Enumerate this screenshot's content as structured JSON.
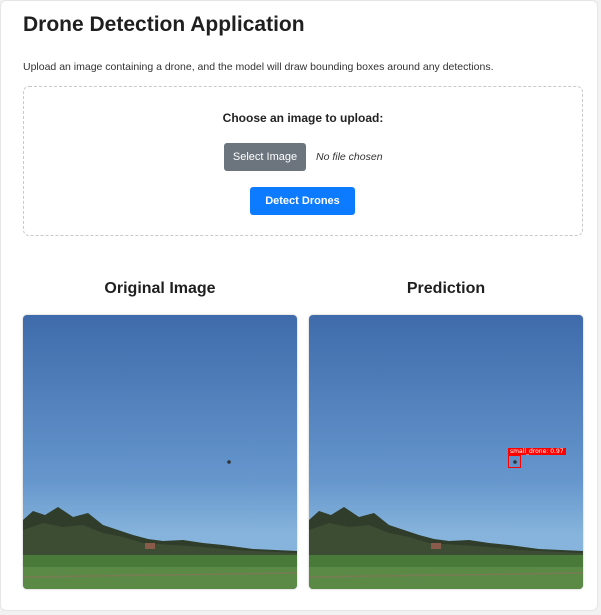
{
  "app": {
    "title": "Drone Detection Application",
    "subtitle": "Upload an image containing a drone, and the model will draw bounding boxes around any detections."
  },
  "upload": {
    "label": "Choose an image to upload:",
    "select_button": "Select Image",
    "file_status": "No file chosen",
    "detect_button": "Detect Drones"
  },
  "panels": {
    "original": {
      "heading": "Original Image"
    },
    "prediction": {
      "heading": "Prediction",
      "detection_label": "small_drone: 0.97"
    }
  },
  "colors": {
    "select_button": "#6c757d",
    "detect_button": "#0d7bff",
    "bounding_box": "#ff0000",
    "sky_top": "#3f6bab",
    "sky_bottom": "#7fb0da",
    "field": "#4a7a3a"
  }
}
